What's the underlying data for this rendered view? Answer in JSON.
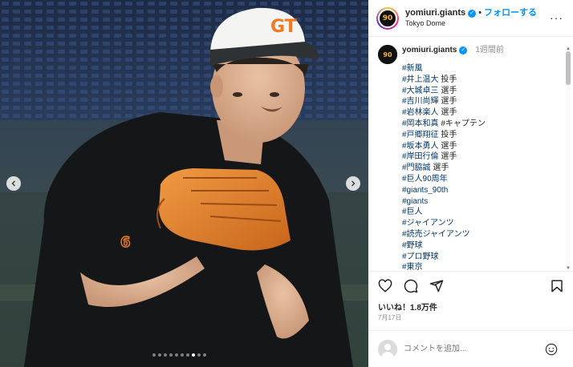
{
  "header": {
    "username": "yomiuri.giants",
    "verified_symbol": "✓",
    "separator": "•",
    "follow_label": "フォローする",
    "location": "Tokyo Dome",
    "more_symbol": "···",
    "avatar_text": "90"
  },
  "caption": {
    "username": "yomiuri.giants",
    "timestamp": "1週間前",
    "avatar_text": "90",
    "lines": [
      {
        "tag": "#新風",
        "suffix": ""
      },
      {
        "tag": "#井上温大",
        "suffix": " 投手"
      },
      {
        "tag": "#大城卓三",
        "suffix": " 選手"
      },
      {
        "tag": "#吉川尚輝",
        "suffix": " 選手"
      },
      {
        "tag": "#岩林楽人",
        "suffix": " 選手"
      },
      {
        "tag": "#岡本和真",
        "suffix": " #キャプテン"
      },
      {
        "tag": "#戸郷翔征",
        "suffix": " 投手"
      },
      {
        "tag": "#坂本勇人",
        "suffix": " 選手"
      },
      {
        "tag": "#岸田行倫",
        "suffix": " 選手"
      },
      {
        "tag": "#門脇誠",
        "suffix": " 選手"
      },
      {
        "tag": "#巨人90周年",
        "suffix": ""
      },
      {
        "tag": "#giants_90th",
        "suffix": ""
      },
      {
        "tag": "#giants",
        "suffix": ""
      },
      {
        "tag": "#巨人",
        "suffix": ""
      },
      {
        "tag": "#ジャイアンツ",
        "suffix": ""
      },
      {
        "tag": "#読売ジャイアンツ",
        "suffix": ""
      },
      {
        "tag": "#野球",
        "suffix": ""
      },
      {
        "tag": "#プロ野球",
        "suffix": ""
      },
      {
        "tag": "#東京",
        "suffix": ""
      }
    ]
  },
  "post": {
    "likes": "いいね！1.8万件",
    "date": "7月17日",
    "carousel": {
      "count": 10,
      "active_index": 7
    }
  },
  "comment": {
    "placeholder": "コメントを追加..."
  },
  "photo": {
    "cap_logo": "GT",
    "jersey_number": "6"
  },
  "colors": {
    "accent": "#0095f6",
    "link": "#00376b",
    "glove": "#e5832b",
    "cap": "#f4f4f2",
    "cap_brim": "#2f3235"
  }
}
